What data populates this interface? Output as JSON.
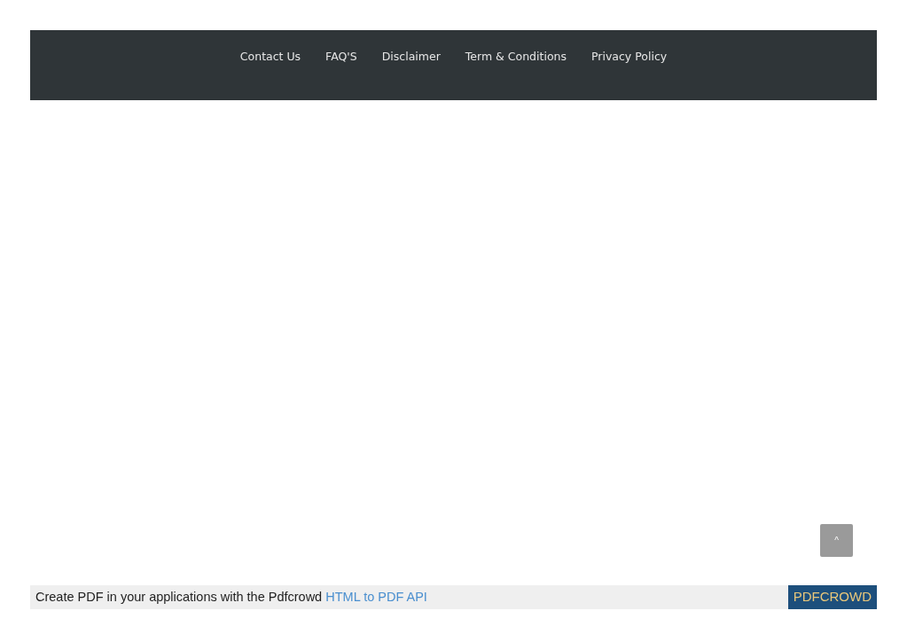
{
  "footer_nav": {
    "links": [
      {
        "label": "Contact Us"
      },
      {
        "label": "FAQ'S"
      },
      {
        "label": "Disclaimer"
      },
      {
        "label": "Term & Conditions"
      },
      {
        "label": "Privacy Policy"
      }
    ]
  },
  "scroll_top_button": {
    "label": "^"
  },
  "pdf_banner": {
    "text": "Create PDF in your applications with the Pdfcrowd",
    "link": "HTML to PDF API",
    "button": "PDFCROWD"
  }
}
